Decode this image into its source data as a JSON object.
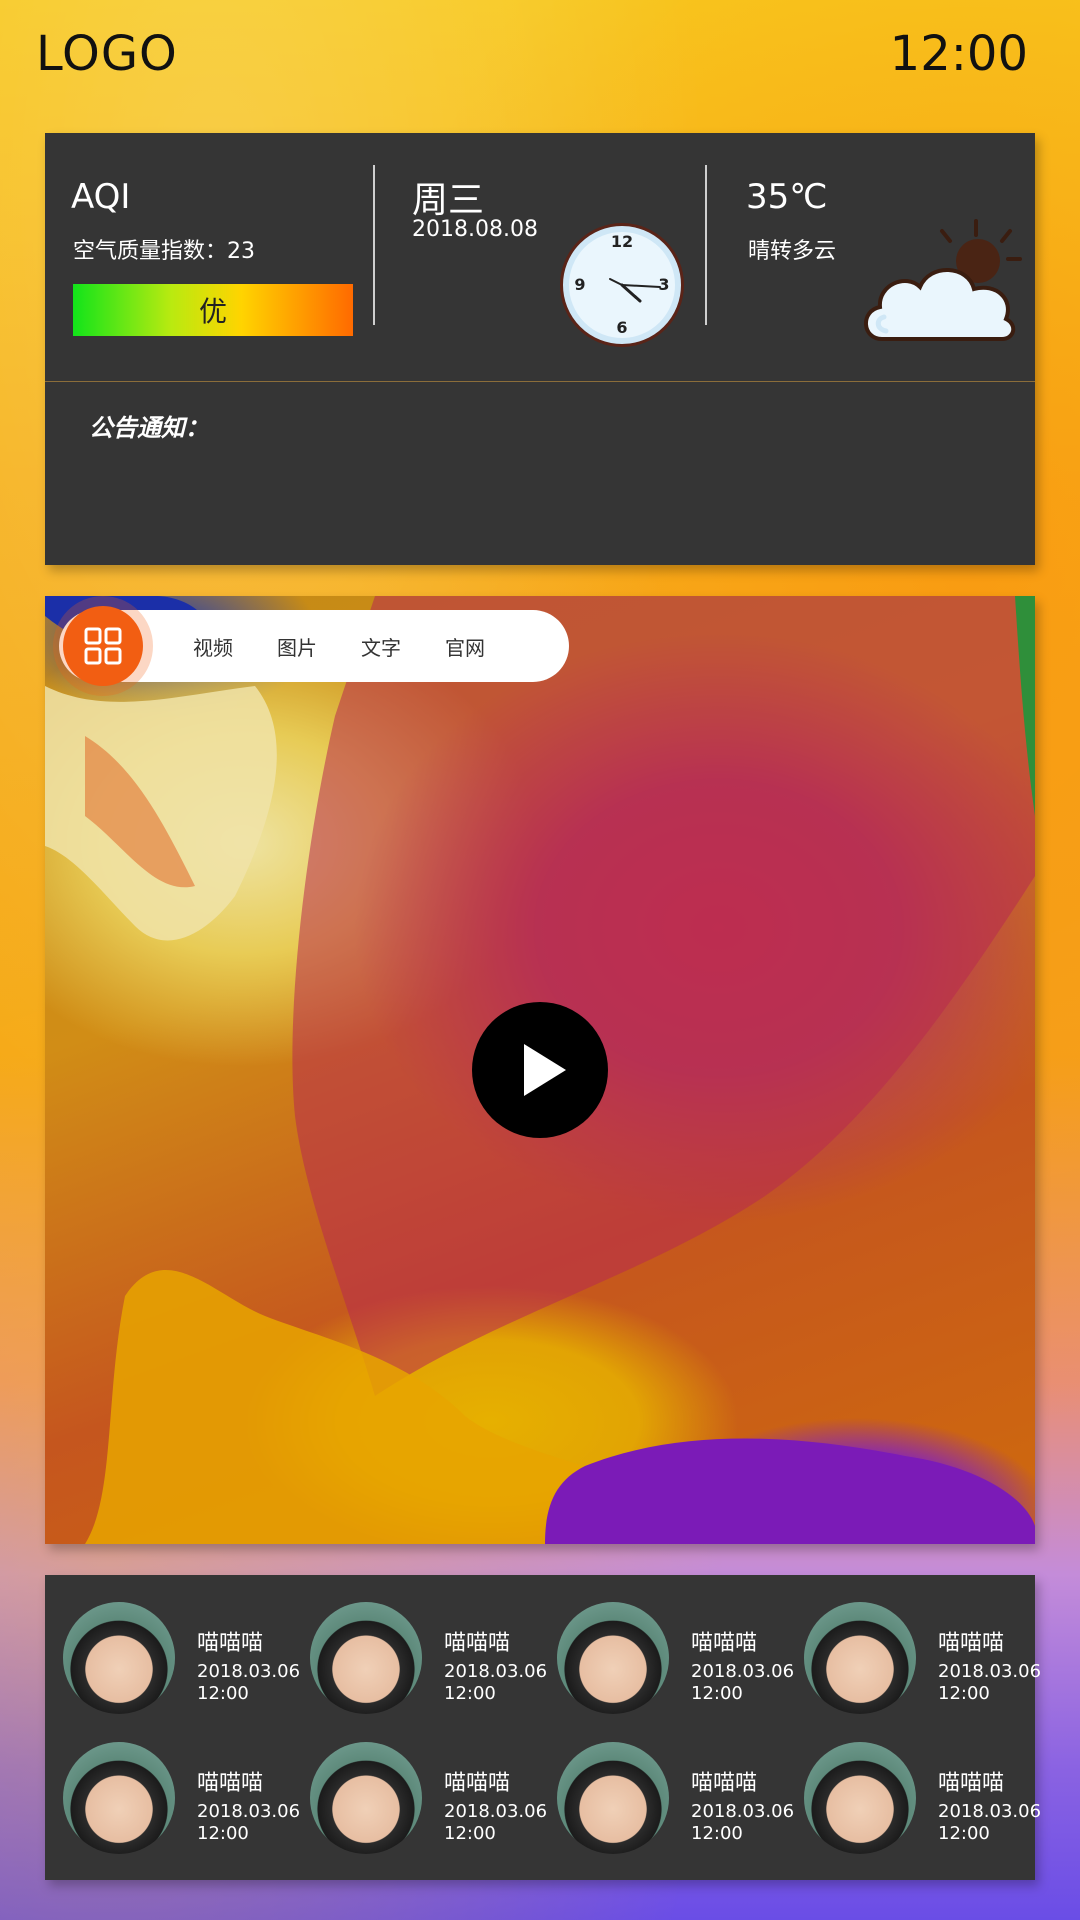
{
  "header": {
    "logo": "LOGO",
    "time": "12:00"
  },
  "aqi": {
    "title": "AQI",
    "label": "空气质量指数：23",
    "level": "优"
  },
  "date_block": {
    "weekday": "周三",
    "date": "2018.08.08",
    "clock_numbers": [
      "12",
      "3",
      "6",
      "9"
    ]
  },
  "weather": {
    "temperature": "35℃",
    "condition": "晴转多云",
    "icon": "cloud-sun-icon"
  },
  "notice": {
    "label": "公告通知："
  },
  "media": {
    "tabs": [
      "视频",
      "图片",
      "文字",
      "官网"
    ],
    "menu_icon": "grid-icon",
    "play_icon": "play-icon",
    "accent_color": "#f25e12"
  },
  "users": [
    {
      "name": "喵喵喵",
      "date": "2018.03.06",
      "time": "12:00"
    },
    {
      "name": "喵喵喵",
      "date": "2018.03.06",
      "time": "12:00"
    },
    {
      "name": "喵喵喵",
      "date": "2018.03.06",
      "time": "12:00"
    },
    {
      "name": "喵喵喵",
      "date": "2018.03.06",
      "time": "12:00"
    },
    {
      "name": "喵喵喵",
      "date": "2018.03.06",
      "time": "12:00"
    },
    {
      "name": "喵喵喵",
      "date": "2018.03.06",
      "time": "12:00"
    },
    {
      "name": "喵喵喵",
      "date": "2018.03.06",
      "time": "12:00"
    },
    {
      "name": "喵喵喵",
      "date": "2018.03.06",
      "time": "12:00"
    }
  ]
}
